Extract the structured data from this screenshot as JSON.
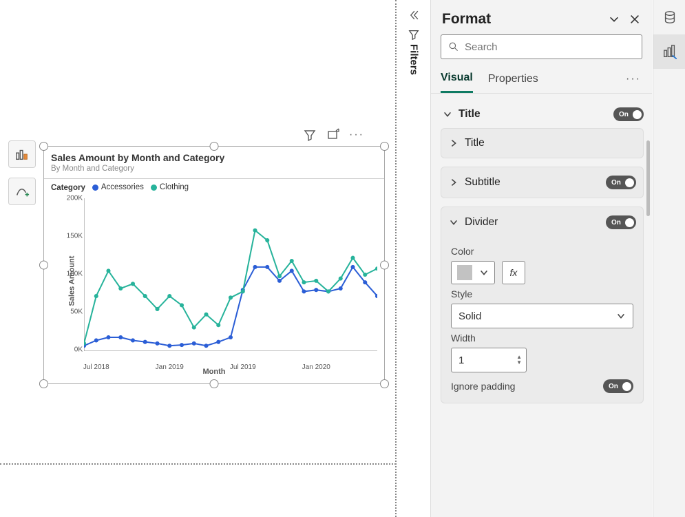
{
  "filters_label": "Filters",
  "visual": {
    "title": "Sales Amount by Month and Category",
    "subtitle": "By Month and Category",
    "legend_label": "Category",
    "x_axis": "Month",
    "y_axis": "Sales Amount"
  },
  "format": {
    "panel_title": "Format",
    "search_placeholder": "Search",
    "tabs": {
      "visual": "Visual",
      "properties": "Properties"
    },
    "groups": {
      "title": "Title",
      "sub_title": "Title",
      "subtitle": "Subtitle",
      "divider": "Divider"
    },
    "divider": {
      "color_label": "Color",
      "fx": "fx",
      "style_label": "Style",
      "style_value": "Solid",
      "width_label": "Width",
      "width_value": "1",
      "ignore_label": "Ignore padding"
    },
    "toggle_on": "On"
  },
  "chart_data": {
    "type": "line",
    "title": "Sales Amount by Month and Category",
    "subtitle": "By Month and Category",
    "xlabel": "Month",
    "ylabel": "Sales Amount",
    "ylim": [
      0,
      200000
    ],
    "y_ticks": [
      "0K",
      "50K",
      "100K",
      "150K",
      "200K"
    ],
    "legend_title": "Category",
    "x_tick_labels": [
      "Jul 2018",
      "Jan 2019",
      "Jul 2019",
      "Jan 2020"
    ],
    "x_index_range": [
      0,
      33
    ],
    "categories": [
      "2018-06",
      "2018-07",
      "2018-08",
      "2018-09",
      "2018-10",
      "2018-11",
      "2018-12",
      "2019-01",
      "2019-02",
      "2019-03",
      "2019-04",
      "2019-05",
      "2019-06",
      "2019-07",
      "2019-08",
      "2019-09",
      "2019-10",
      "2019-11",
      "2019-12",
      "2020-01",
      "2020-02",
      "2020-03",
      "2020-04",
      "2020-05",
      "2020-06"
    ],
    "series": [
      {
        "name": "Accessories",
        "color": "#2b5ed6",
        "values": [
          7000,
          14000,
          18000,
          18000,
          14000,
          12000,
          10000,
          7000,
          8000,
          10000,
          7000,
          12000,
          18000,
          80000,
          110000,
          110000,
          92000,
          105000,
          78000,
          80000,
          78000,
          82000,
          110000,
          90000,
          72000
        ]
      },
      {
        "name": "Clothing",
        "color": "#27b39b",
        "values": [
          10000,
          72000,
          105000,
          82000,
          88000,
          72000,
          55000,
          72000,
          60000,
          31000,
          48000,
          34000,
          70000,
          78000,
          158000,
          145000,
          98000,
          118000,
          90000,
          92000,
          78000,
          95000,
          122000,
          100000,
          108000
        ]
      }
    ]
  }
}
